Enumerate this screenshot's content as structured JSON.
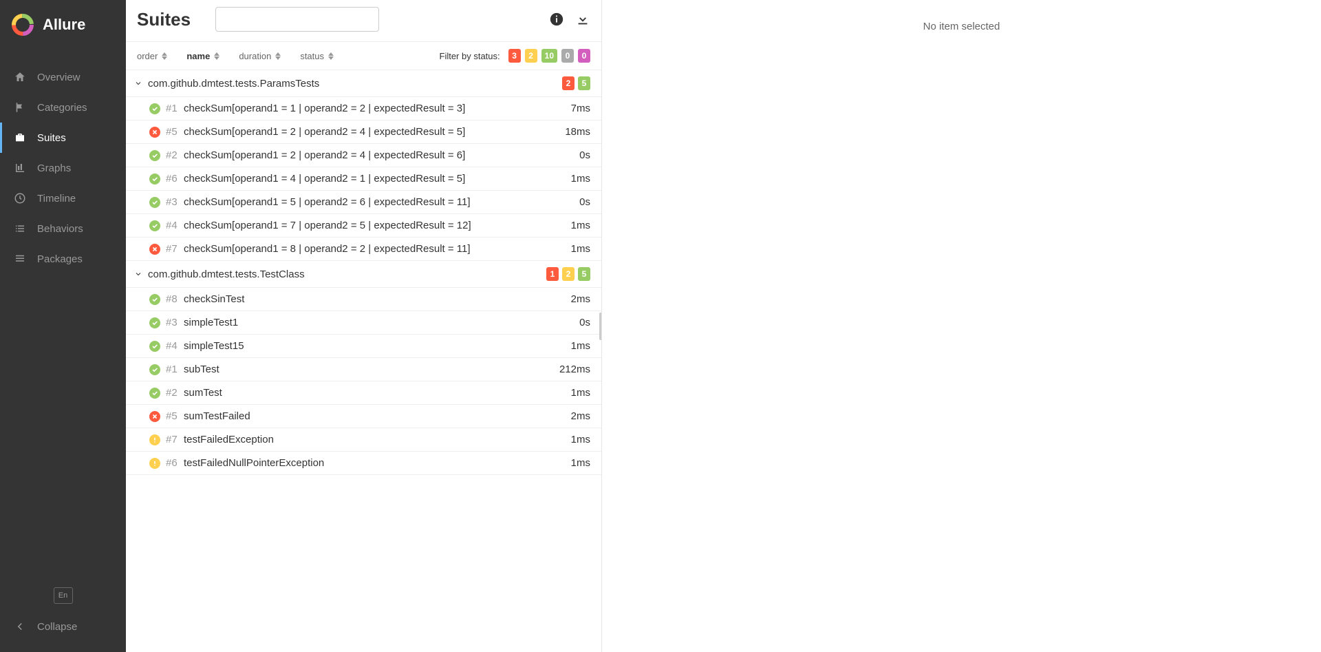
{
  "brand": "Allure",
  "nav": {
    "overview": "Overview",
    "categories": "Categories",
    "suites": "Suites",
    "graphs": "Graphs",
    "timeline": "Timeline",
    "behaviors": "Behaviors",
    "packages": "Packages"
  },
  "lang": "En",
  "collapse": "Collapse",
  "header": {
    "title": "Suites"
  },
  "sort": {
    "order": "order",
    "name": "name",
    "duration": "duration",
    "status": "status"
  },
  "filter": {
    "label": "Filter by status:",
    "failed": "3",
    "broken": "2",
    "passed": "10",
    "skipped": "0",
    "unknown": "0"
  },
  "suites": [
    {
      "name": "com.github.dmtest.tests.ParamsTests",
      "badges": {
        "failed": "2",
        "passed": "5"
      },
      "tests": [
        {
          "status": "passed",
          "num": "#1",
          "name": "checkSum[operand1 = 1 | operand2 = 2 | expectedResult = 3]",
          "duration": "7ms"
        },
        {
          "status": "failed",
          "num": "#5",
          "name": "checkSum[operand1 = 2 | operand2 = 4 | expectedResult = 5]",
          "duration": "18ms"
        },
        {
          "status": "passed",
          "num": "#2",
          "name": "checkSum[operand1 = 2 | operand2 = 4 | expectedResult = 6]",
          "duration": "0s"
        },
        {
          "status": "passed",
          "num": "#6",
          "name": "checkSum[operand1 = 4 | operand2 = 1 | expectedResult = 5]",
          "duration": "1ms"
        },
        {
          "status": "passed",
          "num": "#3",
          "name": "checkSum[operand1 = 5 | operand2 = 6 | expectedResult = 11]",
          "duration": "0s"
        },
        {
          "status": "passed",
          "num": "#4",
          "name": "checkSum[operand1 = 7 | operand2 = 5 | expectedResult = 12]",
          "duration": "1ms"
        },
        {
          "status": "failed",
          "num": "#7",
          "name": "checkSum[operand1 = 8 | operand2 = 2 | expectedResult = 11]",
          "duration": "1ms"
        }
      ]
    },
    {
      "name": "com.github.dmtest.tests.TestClass",
      "badges": {
        "failed": "1",
        "broken": "2",
        "passed": "5"
      },
      "tests": [
        {
          "status": "passed",
          "num": "#8",
          "name": "checkSinTest",
          "duration": "2ms"
        },
        {
          "status": "passed",
          "num": "#3",
          "name": "simpleTest1",
          "duration": "0s"
        },
        {
          "status": "passed",
          "num": "#4",
          "name": "simpleTest15",
          "duration": "1ms"
        },
        {
          "status": "passed",
          "num": "#1",
          "name": "subTest",
          "duration": "212ms"
        },
        {
          "status": "passed",
          "num": "#2",
          "name": "sumTest",
          "duration": "1ms"
        },
        {
          "status": "failed",
          "num": "#5",
          "name": "sumTestFailed",
          "duration": "2ms"
        },
        {
          "status": "broken",
          "num": "#7",
          "name": "testFailedException",
          "duration": "1ms"
        },
        {
          "status": "broken",
          "num": "#6",
          "name": "testFailedNullPointerException",
          "duration": "1ms"
        }
      ]
    }
  ],
  "detail": {
    "empty": "No item selected"
  }
}
